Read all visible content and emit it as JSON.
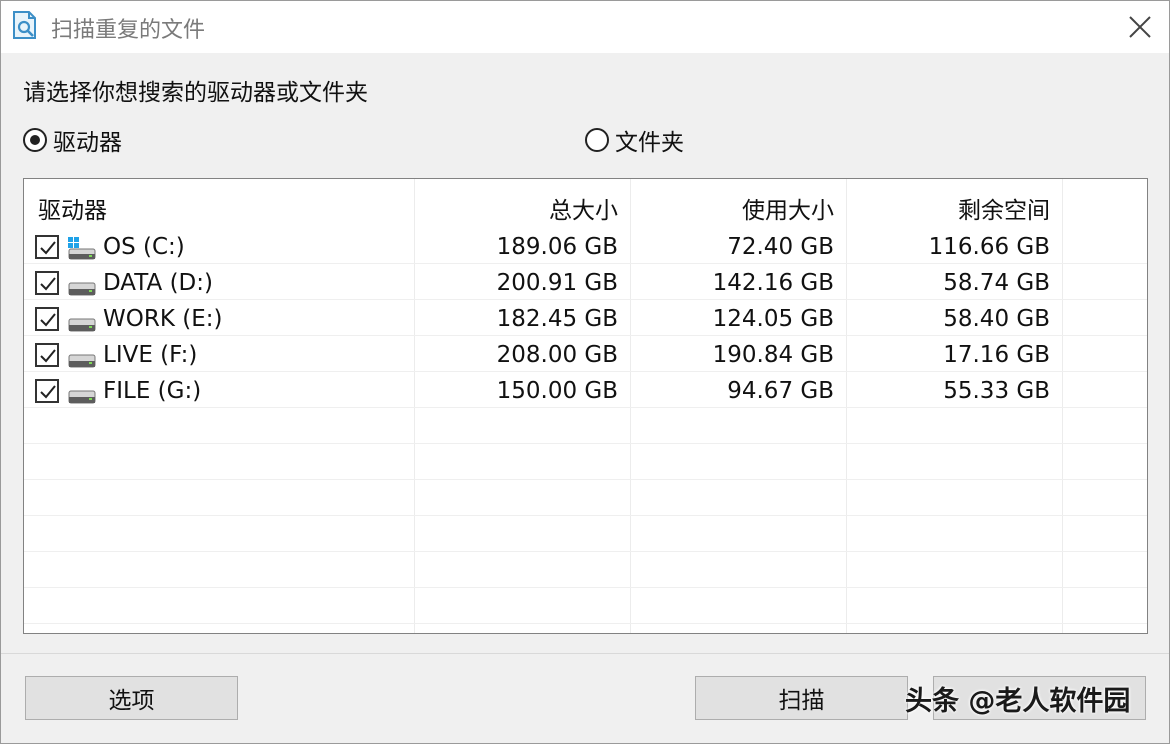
{
  "window": {
    "title": "扫描重复的文件",
    "close_icon": "close-icon"
  },
  "prompt": "请选择你想搜索的驱动器或文件夹",
  "scan_target": {
    "options": [
      {
        "label": "驱动器",
        "checked": true
      },
      {
        "label": "文件夹",
        "checked": false
      }
    ]
  },
  "drives_table": {
    "columns": [
      "驱动器",
      "总大小",
      "使用大小",
      "剩余空间"
    ],
    "rows": [
      {
        "name": "OS (C:)",
        "total": "189.06 GB",
        "used": "72.40 GB",
        "free": "116.66 GB",
        "checked": true,
        "icon": "windows-drive-icon"
      },
      {
        "name": "DATA (D:)",
        "total": "200.91 GB",
        "used": "142.16 GB",
        "free": "58.74 GB",
        "checked": true,
        "icon": "hard-drive-icon"
      },
      {
        "name": "WORK (E:)",
        "total": "182.45 GB",
        "used": "124.05 GB",
        "free": "58.40 GB",
        "checked": true,
        "icon": "hard-drive-icon"
      },
      {
        "name": "LIVE (F:)",
        "total": "208.00 GB",
        "used": "190.84 GB",
        "free": "17.16 GB",
        "checked": true,
        "icon": "hard-drive-icon"
      },
      {
        "name": "FILE (G:)",
        "total": "150.00 GB",
        "used": "94.67 GB",
        "free": "55.33 GB",
        "checked": true,
        "icon": "hard-drive-icon"
      }
    ]
  },
  "buttons": {
    "options": "选项",
    "scan": "扫描"
  },
  "watermark": "头条 @老人软件园"
}
